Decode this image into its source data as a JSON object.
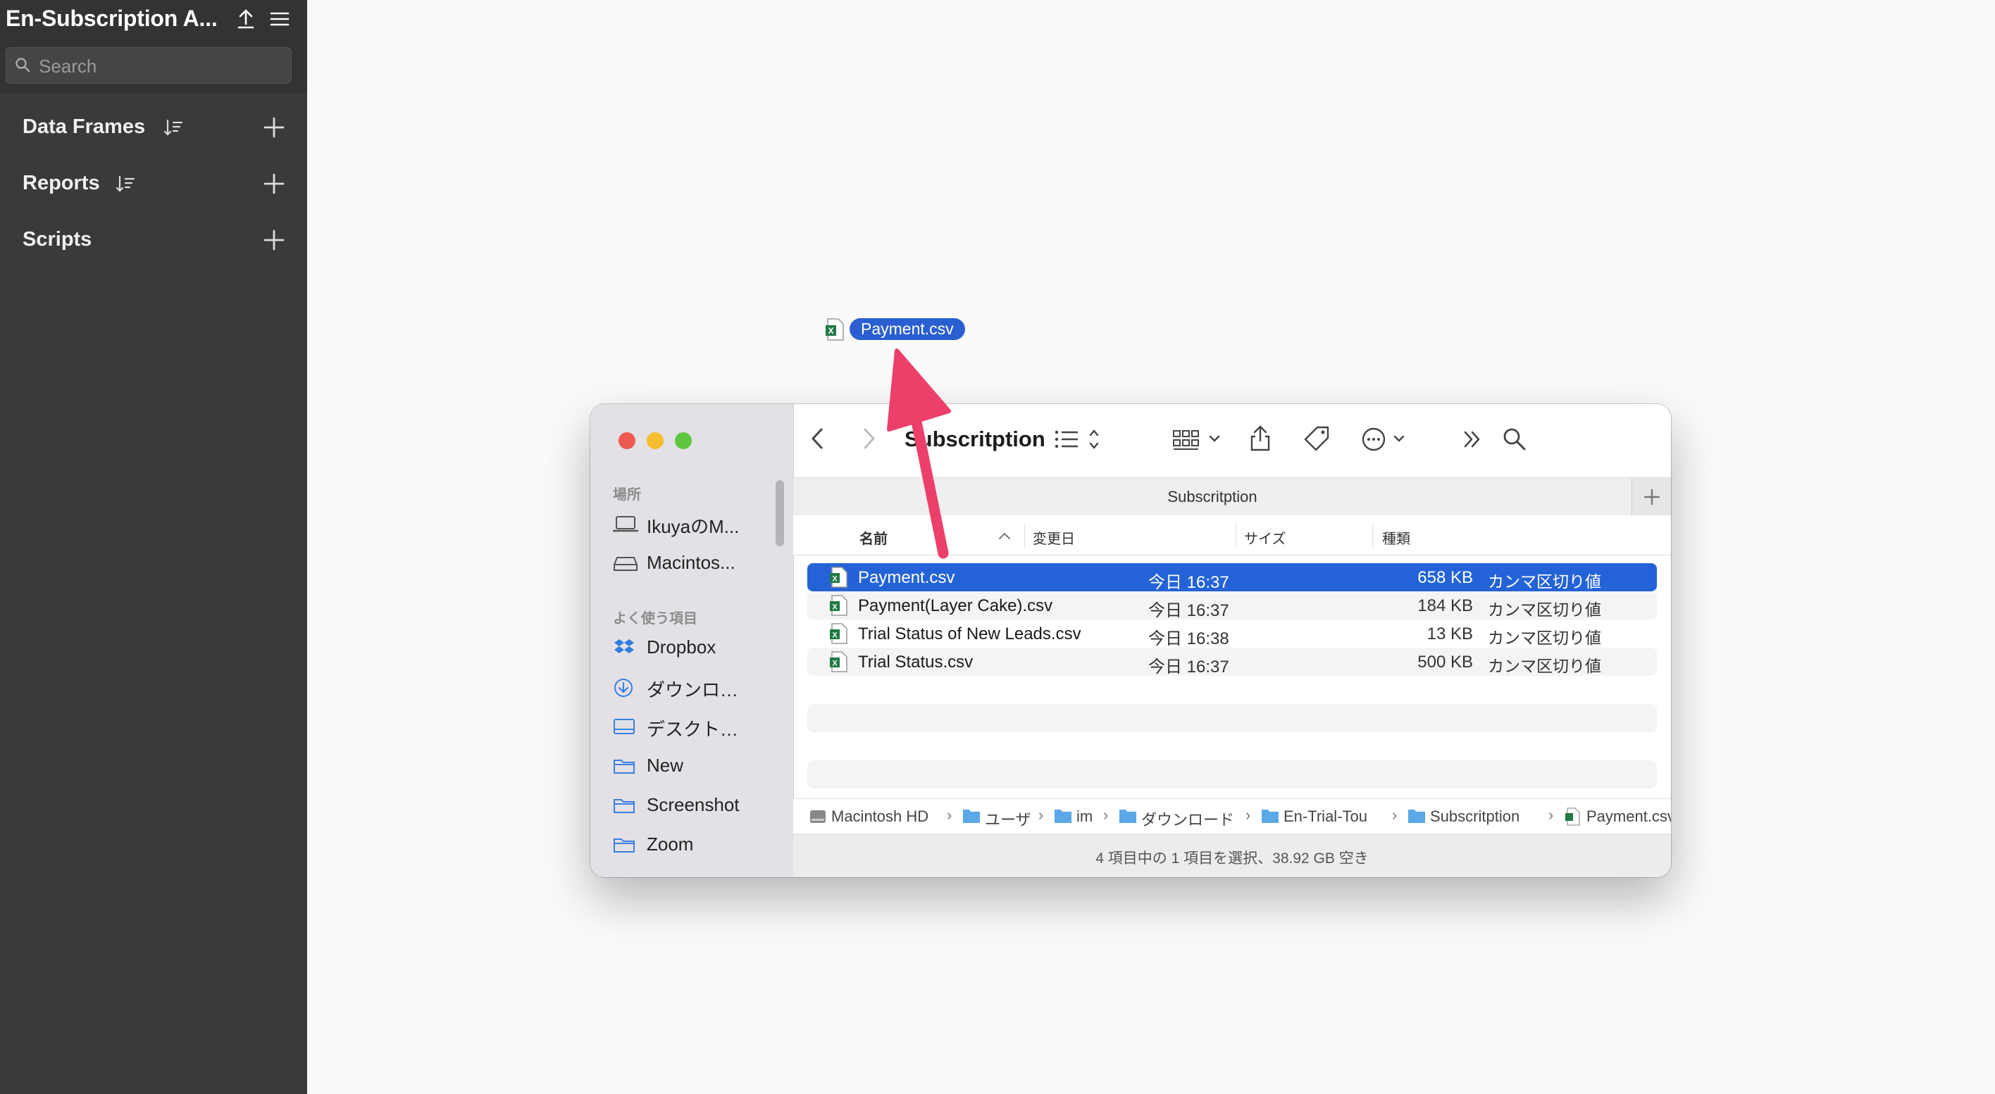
{
  "app": {
    "title": "En-Subscription A...",
    "search_placeholder": "Search",
    "sections": [
      {
        "label": "Data Frames"
      },
      {
        "label": "Reports"
      },
      {
        "label": "Scripts"
      }
    ]
  },
  "drag": {
    "filename": "Payment.csv"
  },
  "finder": {
    "title": "Subscritption",
    "tab_title": "Subscritption",
    "sidebar": {
      "groups": [
        "場所",
        "よく使う項目"
      ],
      "locations": [
        {
          "label": "IkuyaのM...",
          "icon": "laptop-icon"
        },
        {
          "label": "Macintos...",
          "icon": "drive-icon"
        }
      ],
      "favorites": [
        {
          "label": "Dropbox",
          "icon": "dropbox-icon"
        },
        {
          "label": "ダウンロ…",
          "icon": "download-icon"
        },
        {
          "label": "デスクト…",
          "icon": "desktop-icon"
        },
        {
          "label": "New",
          "icon": "folder-icon"
        },
        {
          "label": "Screenshot",
          "icon": "folder-icon"
        },
        {
          "label": "Zoom",
          "icon": "folder-icon"
        }
      ]
    },
    "columns": {
      "name": "名前",
      "date": "変更日",
      "size": "サイズ",
      "kind": "種類"
    },
    "files": [
      {
        "name": "Payment.csv",
        "date": "今日 16:37",
        "size": "658 KB",
        "kind": "カンマ区切り値",
        "selected": true
      },
      {
        "name": "Payment(Layer Cake).csv",
        "date": "今日 16:37",
        "size": "184 KB",
        "kind": "カンマ区切り値"
      },
      {
        "name": "Trial Status of New Leads.csv",
        "date": "今日 16:38",
        "size": "13 KB",
        "kind": "カンマ区切り値"
      },
      {
        "name": "Trial Status.csv",
        "date": "今日 16:37",
        "size": "500 KB",
        "kind": "カンマ区切り値"
      }
    ],
    "path": [
      {
        "label": "Macintosh HD"
      },
      {
        "label": "ユーザ"
      },
      {
        "label": "im"
      },
      {
        "label": "ダウンロード"
      },
      {
        "label": "En-Trial-Tou"
      },
      {
        "label": "Subscritption"
      },
      {
        "label": "Payment.csv"
      }
    ],
    "status": "4 項目中の 1 項目を選択、38.92 GB 空き"
  },
  "colors": {
    "app_sidebar": "#3a3a3a",
    "selection": "#2463d7",
    "arrow": "#ec3f6a",
    "traffic_red": "#ee5a52",
    "traffic_yellow": "#f5bd2f",
    "traffic_green": "#5ec73f"
  }
}
